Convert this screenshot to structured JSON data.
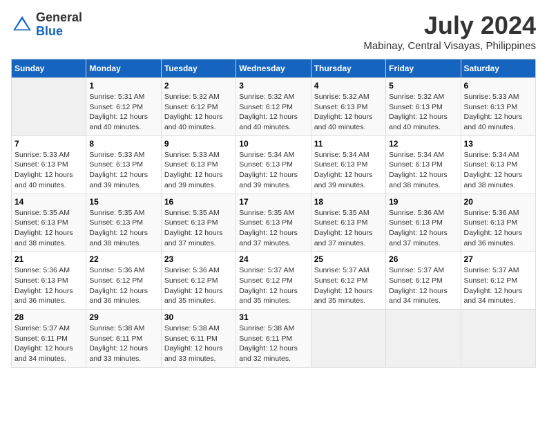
{
  "header": {
    "logo_line1": "General",
    "logo_line2": "Blue",
    "title": "July 2024",
    "subtitle": "Mabinay, Central Visayas, Philippines"
  },
  "calendar": {
    "days_of_week": [
      "Sunday",
      "Monday",
      "Tuesday",
      "Wednesday",
      "Thursday",
      "Friday",
      "Saturday"
    ],
    "weeks": [
      [
        {
          "day": "",
          "sunrise": "",
          "sunset": "",
          "daylight": ""
        },
        {
          "day": "1",
          "sunrise": "Sunrise: 5:31 AM",
          "sunset": "Sunset: 6:12 PM",
          "daylight": "Daylight: 12 hours and 40 minutes."
        },
        {
          "day": "2",
          "sunrise": "Sunrise: 5:32 AM",
          "sunset": "Sunset: 6:12 PM",
          "daylight": "Daylight: 12 hours and 40 minutes."
        },
        {
          "day": "3",
          "sunrise": "Sunrise: 5:32 AM",
          "sunset": "Sunset: 6:12 PM",
          "daylight": "Daylight: 12 hours and 40 minutes."
        },
        {
          "day": "4",
          "sunrise": "Sunrise: 5:32 AM",
          "sunset": "Sunset: 6:13 PM",
          "daylight": "Daylight: 12 hours and 40 minutes."
        },
        {
          "day": "5",
          "sunrise": "Sunrise: 5:32 AM",
          "sunset": "Sunset: 6:13 PM",
          "daylight": "Daylight: 12 hours and 40 minutes."
        },
        {
          "day": "6",
          "sunrise": "Sunrise: 5:33 AM",
          "sunset": "Sunset: 6:13 PM",
          "daylight": "Daylight: 12 hours and 40 minutes."
        }
      ],
      [
        {
          "day": "7",
          "sunrise": "Sunrise: 5:33 AM",
          "sunset": "Sunset: 6:13 PM",
          "daylight": "Daylight: 12 hours and 40 minutes."
        },
        {
          "day": "8",
          "sunrise": "Sunrise: 5:33 AM",
          "sunset": "Sunset: 6:13 PM",
          "daylight": "Daylight: 12 hours and 39 minutes."
        },
        {
          "day": "9",
          "sunrise": "Sunrise: 5:33 AM",
          "sunset": "Sunset: 6:13 PM",
          "daylight": "Daylight: 12 hours and 39 minutes."
        },
        {
          "day": "10",
          "sunrise": "Sunrise: 5:34 AM",
          "sunset": "Sunset: 6:13 PM",
          "daylight": "Daylight: 12 hours and 39 minutes."
        },
        {
          "day": "11",
          "sunrise": "Sunrise: 5:34 AM",
          "sunset": "Sunset: 6:13 PM",
          "daylight": "Daylight: 12 hours and 39 minutes."
        },
        {
          "day": "12",
          "sunrise": "Sunrise: 5:34 AM",
          "sunset": "Sunset: 6:13 PM",
          "daylight": "Daylight: 12 hours and 38 minutes."
        },
        {
          "day": "13",
          "sunrise": "Sunrise: 5:34 AM",
          "sunset": "Sunset: 6:13 PM",
          "daylight": "Daylight: 12 hours and 38 minutes."
        }
      ],
      [
        {
          "day": "14",
          "sunrise": "Sunrise: 5:35 AM",
          "sunset": "Sunset: 6:13 PM",
          "daylight": "Daylight: 12 hours and 38 minutes."
        },
        {
          "day": "15",
          "sunrise": "Sunrise: 5:35 AM",
          "sunset": "Sunset: 6:13 PM",
          "daylight": "Daylight: 12 hours and 38 minutes."
        },
        {
          "day": "16",
          "sunrise": "Sunrise: 5:35 AM",
          "sunset": "Sunset: 6:13 PM",
          "daylight": "Daylight: 12 hours and 37 minutes."
        },
        {
          "day": "17",
          "sunrise": "Sunrise: 5:35 AM",
          "sunset": "Sunset: 6:13 PM",
          "daylight": "Daylight: 12 hours and 37 minutes."
        },
        {
          "day": "18",
          "sunrise": "Sunrise: 5:35 AM",
          "sunset": "Sunset: 6:13 PM",
          "daylight": "Daylight: 12 hours and 37 minutes."
        },
        {
          "day": "19",
          "sunrise": "Sunrise: 5:36 AM",
          "sunset": "Sunset: 6:13 PM",
          "daylight": "Daylight: 12 hours and 37 minutes."
        },
        {
          "day": "20",
          "sunrise": "Sunrise: 5:36 AM",
          "sunset": "Sunset: 6:13 PM",
          "daylight": "Daylight: 12 hours and 36 minutes."
        }
      ],
      [
        {
          "day": "21",
          "sunrise": "Sunrise: 5:36 AM",
          "sunset": "Sunset: 6:13 PM",
          "daylight": "Daylight: 12 hours and 36 minutes."
        },
        {
          "day": "22",
          "sunrise": "Sunrise: 5:36 AM",
          "sunset": "Sunset: 6:12 PM",
          "daylight": "Daylight: 12 hours and 36 minutes."
        },
        {
          "day": "23",
          "sunrise": "Sunrise: 5:36 AM",
          "sunset": "Sunset: 6:12 PM",
          "daylight": "Daylight: 12 hours and 35 minutes."
        },
        {
          "day": "24",
          "sunrise": "Sunrise: 5:37 AM",
          "sunset": "Sunset: 6:12 PM",
          "daylight": "Daylight: 12 hours and 35 minutes."
        },
        {
          "day": "25",
          "sunrise": "Sunrise: 5:37 AM",
          "sunset": "Sunset: 6:12 PM",
          "daylight": "Daylight: 12 hours and 35 minutes."
        },
        {
          "day": "26",
          "sunrise": "Sunrise: 5:37 AM",
          "sunset": "Sunset: 6:12 PM",
          "daylight": "Daylight: 12 hours and 34 minutes."
        },
        {
          "day": "27",
          "sunrise": "Sunrise: 5:37 AM",
          "sunset": "Sunset: 6:12 PM",
          "daylight": "Daylight: 12 hours and 34 minutes."
        }
      ],
      [
        {
          "day": "28",
          "sunrise": "Sunrise: 5:37 AM",
          "sunset": "Sunset: 6:11 PM",
          "daylight": "Daylight: 12 hours and 34 minutes."
        },
        {
          "day": "29",
          "sunrise": "Sunrise: 5:38 AM",
          "sunset": "Sunset: 6:11 PM",
          "daylight": "Daylight: 12 hours and 33 minutes."
        },
        {
          "day": "30",
          "sunrise": "Sunrise: 5:38 AM",
          "sunset": "Sunset: 6:11 PM",
          "daylight": "Daylight: 12 hours and 33 minutes."
        },
        {
          "day": "31",
          "sunrise": "Sunrise: 5:38 AM",
          "sunset": "Sunset: 6:11 PM",
          "daylight": "Daylight: 12 hours and 32 minutes."
        },
        {
          "day": "",
          "sunrise": "",
          "sunset": "",
          "daylight": ""
        },
        {
          "day": "",
          "sunrise": "",
          "sunset": "",
          "daylight": ""
        },
        {
          "day": "",
          "sunrise": "",
          "sunset": "",
          "daylight": ""
        }
      ]
    ]
  }
}
